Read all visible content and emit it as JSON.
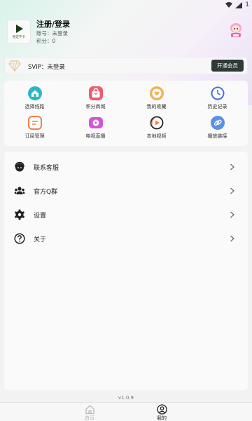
{
  "status_bar": {
    "battery_text": "1"
  },
  "profile": {
    "logo_text": "稳定不卡",
    "title": "注册/登录",
    "account_line": "账号：未登录",
    "points_line": "积分：0"
  },
  "svip": {
    "label": "SVIP：未登录",
    "button": "开通会员"
  },
  "grid": [
    {
      "label": "选择线路",
      "icon": "home-route-icon",
      "color": "#2bb5c9"
    },
    {
      "label": "积分商城",
      "icon": "shopping-bag-icon",
      "color": "#ef5b6c"
    },
    {
      "label": "我的收藏",
      "icon": "heart-icon",
      "color": "#f0b35a"
    },
    {
      "label": "历史记录",
      "icon": "clock-icon",
      "color": "#4a6fd8"
    },
    {
      "label": "订阅管理",
      "icon": "subscription-icon",
      "color": "#f27f4f"
    },
    {
      "label": "电视直播",
      "icon": "tv-play-icon",
      "color": "#d454d8"
    },
    {
      "label": "本地视频",
      "icon": "local-video-icon",
      "color": "#222222"
    },
    {
      "label": "播放链接",
      "icon": "link-icon",
      "color": "#5d8fe6"
    }
  ],
  "menu": [
    {
      "label": "联系客服",
      "icon": "customer-service-icon"
    },
    {
      "label": "官方Q群",
      "icon": "group-icon"
    },
    {
      "label": "设置",
      "icon": "gear-icon"
    },
    {
      "label": "关于",
      "icon": "help-icon"
    }
  ],
  "version": "v1.0.9",
  "nav": {
    "home": {
      "label": "首页",
      "color": "#b8b8b8"
    },
    "mine": {
      "label": "我的",
      "color": "#222222"
    }
  }
}
